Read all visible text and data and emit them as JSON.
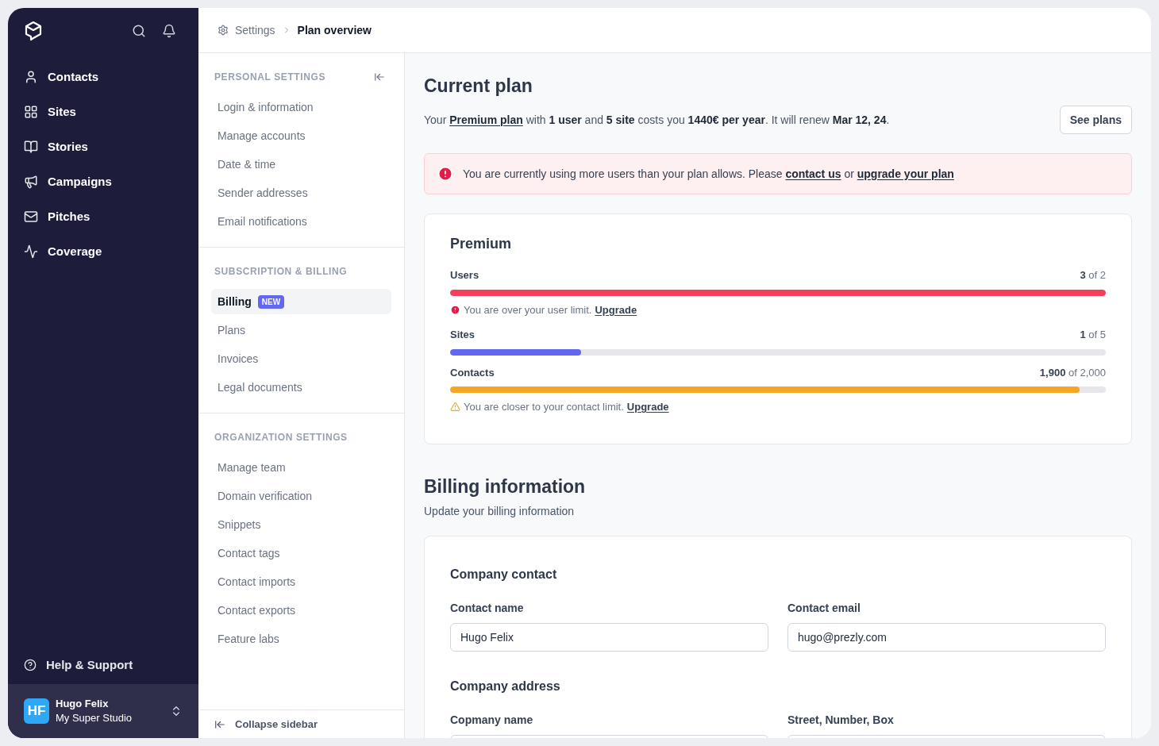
{
  "sidebar": {
    "items": [
      {
        "label": "Contacts"
      },
      {
        "label": "Sites"
      },
      {
        "label": "Stories"
      },
      {
        "label": "Campaigns"
      },
      {
        "label": "Pitches"
      },
      {
        "label": "Coverage"
      }
    ],
    "help": "Help & Support",
    "user": {
      "initials": "HF",
      "name": "Hugo Felix",
      "org": "My Super Studio"
    }
  },
  "breadcrumb": [
    "Settings",
    "Plan overview"
  ],
  "settings_nav": {
    "sections": [
      {
        "title": "PERSONAL SETTINGS",
        "items": [
          {
            "label": "Login & information",
            "selected": false
          },
          {
            "label": "Manage accounts",
            "selected": false
          },
          {
            "label": "Date & time",
            "selected": false
          },
          {
            "label": "Sender addresses",
            "selected": false
          },
          {
            "label": "Email notifications",
            "selected": false
          }
        ]
      },
      {
        "title": "SUBSCRIPTION & BILLING",
        "items": [
          {
            "label": "Billing",
            "selected": true,
            "badge": "NEW"
          },
          {
            "label": "Plans",
            "selected": false
          },
          {
            "label": "Invoices",
            "selected": false
          },
          {
            "label": "Legal documents",
            "selected": false
          }
        ]
      },
      {
        "title": "ORGANIZATION SETTINGS",
        "items": [
          {
            "label": "Manage team",
            "selected": false
          },
          {
            "label": "Domain verification",
            "selected": false
          },
          {
            "label": "Snippets",
            "selected": false
          },
          {
            "label": "Contact tags",
            "selected": false
          },
          {
            "label": "Contact imports",
            "selected": false
          },
          {
            "label": "Contact exports",
            "selected": false
          },
          {
            "label": "Feature labs",
            "selected": false
          }
        ]
      }
    ],
    "collapse": "Collapse sidebar"
  },
  "current_plan": {
    "title": "Current plan",
    "summary": [
      {
        "kind": "plain",
        "text": "Your "
      },
      {
        "kind": "link",
        "text": "Premium plan"
      },
      {
        "kind": "plain",
        "text": " with "
      },
      {
        "kind": "bold",
        "text": "1 user"
      },
      {
        "kind": "plain",
        "text": " and "
      },
      {
        "kind": "bold",
        "text": "5 site"
      },
      {
        "kind": "plain",
        "text": " costs you "
      },
      {
        "kind": "bold",
        "text": "1440€ per year"
      },
      {
        "kind": "plain",
        "text": ". It will renew "
      },
      {
        "kind": "bold",
        "text": "Mar 12, 24"
      },
      {
        "kind": "plain",
        "text": "."
      }
    ],
    "button": "See plans",
    "alert": [
      {
        "kind": "plain",
        "text": "You are currently using more users than your plan allows. Please "
      },
      {
        "kind": "link",
        "text": "contact us"
      },
      {
        "kind": "plain",
        "text": " or "
      },
      {
        "kind": "link",
        "text": "upgrade your plan"
      }
    ],
    "usage": {
      "title": "Premium",
      "meters": [
        {
          "label": "Users",
          "used": "3",
          "limit": "of 2",
          "level": 1,
          "color": "#f43f5e",
          "note": {
            "kind": "error",
            "text": "You are over your user limit.",
            "link": "Upgrade"
          }
        },
        {
          "label": "Sites",
          "used": "1",
          "limit": "of 5",
          "level": 0.2,
          "color": "#6366f1"
        },
        {
          "label": "Contacts",
          "used": "1,900",
          "limit": "of 2,000",
          "level": 0.96,
          "color": "#f5a623",
          "note": {
            "kind": "warning",
            "text": "You are closer to your contact limit.",
            "link": "Upgrade"
          }
        }
      ]
    }
  },
  "billing": {
    "title": "Billing information",
    "subtitle": "Update your billing information",
    "sections": [
      {
        "title": "Company contact",
        "fields": [
          {
            "label": "Contact name",
            "value": "Hugo Felix"
          },
          {
            "label": "Contact email",
            "value": "hugo@prezly.com"
          }
        ]
      },
      {
        "title": "Company address",
        "fields": [
          {
            "label": "Copmany name"
          },
          {
            "label": "Street, Number, Box"
          }
        ]
      }
    ]
  }
}
